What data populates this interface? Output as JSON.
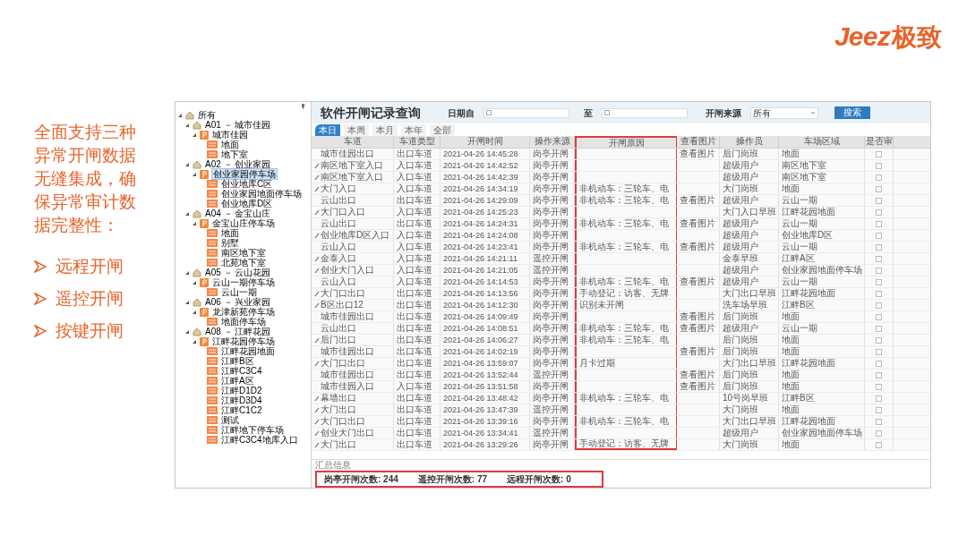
{
  "logo": {
    "latin": "Jeez",
    "chinese": "极致"
  },
  "intro": {
    "text": "全面支持三种异常开闸数据无缝集成，确保异常审计数据完整性：",
    "bullets": [
      "远程开闸",
      "遥控开闸",
      "按键开闸"
    ]
  },
  "tree": [
    {
      "label": "所有",
      "kind": "root",
      "expanded": true,
      "selected": false,
      "children": [
        {
          "label": "A01 － 城市佳园",
          "kind": "site",
          "expanded": true,
          "selected": false,
          "children": [
            {
              "label": "城市佳园",
              "kind": "lot",
              "expanded": true,
              "selected": false,
              "children": [
                {
                  "label": "地面",
                  "kind": "area",
                  "selected": false
                },
                {
                  "label": "地下室",
                  "kind": "area",
                  "selected": false
                }
              ]
            }
          ]
        },
        {
          "label": "A02 － 创业家园",
          "kind": "site",
          "expanded": true,
          "selected": false,
          "children": [
            {
              "label": "创业家园停车场",
              "kind": "lot",
              "expanded": true,
              "selected": true,
              "children": [
                {
                  "label": "创业地库C区",
                  "kind": "area",
                  "selected": false
                },
                {
                  "label": "创业家园地面停车场",
                  "kind": "area",
                  "selected": false
                },
                {
                  "label": "创业地库D区",
                  "kind": "area",
                  "selected": false
                }
              ]
            }
          ]
        },
        {
          "label": "A04 － 金宝山庄",
          "kind": "site",
          "expanded": true,
          "selected": false,
          "children": [
            {
              "label": "金宝山庄停车场",
              "kind": "lot",
              "expanded": true,
              "selected": false,
              "children": [
                {
                  "label": "地面",
                  "kind": "area",
                  "selected": false
                },
                {
                  "label": "别墅",
                  "kind": "area",
                  "selected": false
                },
                {
                  "label": "南区地下室",
                  "kind": "area",
                  "selected": false
                },
                {
                  "label": "北苑地下室",
                  "kind": "area",
                  "selected": false
                }
              ]
            }
          ]
        },
        {
          "label": "A05 － 云山花园",
          "kind": "site",
          "expanded": true,
          "selected": false,
          "children": [
            {
              "label": "云山一期停车场",
              "kind": "lot",
              "expanded": true,
              "selected": false,
              "children": [
                {
                  "label": "云山一期",
                  "kind": "area",
                  "selected": false
                }
              ]
            }
          ]
        },
        {
          "label": "A06 － 兴业家园",
          "kind": "site",
          "expanded": true,
          "selected": false,
          "children": [
            {
              "label": "龙津新苑停车场",
              "kind": "lot",
              "expanded": true,
              "selected": false,
              "children": [
                {
                  "label": "地面停车场",
                  "kind": "area",
                  "selected": false
                }
              ]
            }
          ]
        },
        {
          "label": "A08 － 江畔花园",
          "kind": "site",
          "expanded": true,
          "selected": false,
          "children": [
            {
              "label": "江畔花园停车场",
              "kind": "lot",
              "expanded": true,
              "selected": false,
              "children": [
                {
                  "label": "江畔花园地面",
                  "kind": "area",
                  "selected": false
                },
                {
                  "label": "江畔B区",
                  "kind": "area",
                  "selected": false
                },
                {
                  "label": "江畔C3C4",
                  "kind": "area",
                  "selected": false
                },
                {
                  "label": "江畔A区",
                  "kind": "area",
                  "selected": false
                },
                {
                  "label": "江畔D1D2",
                  "kind": "area",
                  "selected": false
                },
                {
                  "label": "江畔D3D4",
                  "kind": "area",
                  "selected": false
                },
                {
                  "label": "江畔C1C2",
                  "kind": "area",
                  "selected": false
                },
                {
                  "label": "测试",
                  "kind": "area",
                  "selected": false
                },
                {
                  "label": "江畔地下停车场",
                  "kind": "area",
                  "selected": false
                },
                {
                  "label": "江畔C3C4地库入口",
                  "kind": "area",
                  "selected": false
                }
              ]
            }
          ]
        }
      ]
    }
  ],
  "query": {
    "title": "软件开闸记录查询",
    "date_from": {
      "label": "日期自",
      "checked": false
    },
    "date_to": {
      "label": "至",
      "checked": false
    },
    "source": {
      "label": "开闸来源",
      "value": "所有"
    },
    "search_button": "搜索"
  },
  "tabs": [
    {
      "label": "本日",
      "selected": true
    },
    {
      "label": "本周",
      "selected": false
    },
    {
      "label": "本月",
      "selected": false
    },
    {
      "label": "本年",
      "selected": false
    },
    {
      "label": "全部",
      "selected": false
    }
  ],
  "table": {
    "columns": [
      "车道",
      "车道类型",
      "开闸时间",
      "操作来源",
      "开闸原因",
      "查看图片",
      "操作员",
      "车场区域",
      "是否审"
    ],
    "rows": [
      {
        "marked": false,
        "cells": [
          "城市佳园出口",
          "出口车道",
          "2021-04-26 14:45:28",
          "岗亭开闸",
          "",
          "查看图片",
          "后门岗班",
          "地面"
        ],
        "checked": false
      },
      {
        "marked": true,
        "cells": [
          "南区地下室入口",
          "入口车道",
          "2021-04-26 14:42:52",
          "岗亭开闸",
          "",
          "",
          "超级用户",
          "南区地下室"
        ],
        "checked": false
      },
      {
        "marked": true,
        "cells": [
          "南区地下室入口",
          "入口车道",
          "2021-04-26 14:42:39",
          "岗亭开闸",
          "",
          "",
          "超级用户",
          "南区地下室"
        ],
        "checked": false
      },
      {
        "marked": true,
        "cells": [
          "大门入口",
          "入口车道",
          "2021-04-26 14:34:19",
          "岗亭开闸",
          "非机动车：三轮车、电",
          "",
          "大门岗班",
          "地面"
        ],
        "checked": false
      },
      {
        "marked": false,
        "cells": [
          "云山出口",
          "出口车道",
          "2021-04-26 14:29:09",
          "岗亭开闸",
          "非机动车：三轮车、电",
          "查看图片",
          "超级用户",
          "云山一期"
        ],
        "checked": false
      },
      {
        "marked": true,
        "cells": [
          "大门口入口",
          "入口车道",
          "2021-04-26 14:25:23",
          "岗亭开闸",
          "",
          "",
          "大门入口早班",
          "江畔花园地面"
        ],
        "checked": false
      },
      {
        "marked": false,
        "cells": [
          "云山出口",
          "出口车道",
          "2021-04-26 14:24:31",
          "岗亭开闸",
          "非机动车：三轮车、电",
          "查看图片",
          "超级用户",
          "云山一期"
        ],
        "checked": false
      },
      {
        "marked": true,
        "cells": [
          "创业地库D区入口",
          "入口车道",
          "2021-04-26 14:24:08",
          "岗亭开闸",
          "",
          "",
          "超级用户",
          "创业地库D区"
        ],
        "checked": false
      },
      {
        "marked": false,
        "cells": [
          "云山入口",
          "入口车道",
          "2021-04-26 14:23:41",
          "岗亭开闸",
          "非机动车：三轮车、电",
          "查看图片",
          "超级用户",
          "云山一期"
        ],
        "checked": false
      },
      {
        "marked": true,
        "cells": [
          "金泰入口",
          "入口车道",
          "2021-04-26 14:21:11",
          "遥控开闸",
          "",
          "",
          "金泰早班",
          "江畔A区"
        ],
        "checked": false
      },
      {
        "marked": true,
        "cells": [
          "创业大门入口",
          "入口车道",
          "2021-04-26 14:21:05",
          "遥控开闸",
          "",
          "",
          "超级用户",
          "创业家园地面停车场"
        ],
        "checked": false
      },
      {
        "marked": false,
        "cells": [
          "云山入口",
          "入口车道",
          "2021-04-26 14:14:53",
          "岗亭开闸",
          "非机动车：三轮车、电",
          "查看图片",
          "超级用户",
          "云山一期"
        ],
        "checked": false
      },
      {
        "marked": true,
        "cells": [
          "大门口出口",
          "出口车道",
          "2021-04-26 14:13:56",
          "岗亭开闸",
          "手动登记：访客、无牌",
          "",
          "大门出口早班",
          "江畔花园地面"
        ],
        "checked": false
      },
      {
        "marked": true,
        "cells": [
          "B区出口12",
          "出口车道",
          "2021-04-26 14:12:30",
          "岗亭开闸",
          "识别未开闸",
          "",
          "洗车场早班",
          "江畔B区"
        ],
        "checked": false
      },
      {
        "marked": false,
        "cells": [
          "城市佳园出口",
          "出口车道",
          "2021-04-26 14:09:49",
          "岗亭开闸",
          "",
          "查看图片",
          "后门岗班",
          "地面"
        ],
        "checked": false
      },
      {
        "marked": false,
        "cells": [
          "云山出口",
          "出口车道",
          "2021-04-26 14:08:51",
          "岗亭开闸",
          "非机动车：三轮车、电",
          "查看图片",
          "超级用户",
          "云山一期"
        ],
        "checked": false
      },
      {
        "marked": true,
        "cells": [
          "后门出口",
          "出口车道",
          "2021-04-26 14:06:27",
          "岗亭开闸",
          "非机动车：三轮车、电",
          "",
          "后门岗班",
          "地面"
        ],
        "checked": false
      },
      {
        "marked": false,
        "cells": [
          "城市佳园出口",
          "出口车道",
          "2021-04-26 14:02:19",
          "岗亭开闸",
          "",
          "查看图片",
          "后门岗班",
          "地面"
        ],
        "checked": false
      },
      {
        "marked": true,
        "cells": [
          "大门口出口",
          "出口车道",
          "2021-04-26 13:59:07",
          "岗亭开闸",
          "月卡过期",
          "",
          "大门出口早班",
          "江畔花园地面"
        ],
        "checked": false
      },
      {
        "marked": false,
        "cells": [
          "城市佳园出口",
          "出口车道",
          "2021-04-26 13:52:44",
          "遥控开闸",
          "",
          "查看图片",
          "后门岗班",
          "地面"
        ],
        "checked": false
      },
      {
        "marked": false,
        "cells": [
          "城市佳园入口",
          "入口车道",
          "2021-04-26 13:51:58",
          "岗亭开闸",
          "",
          "查看图片",
          "后门岗班",
          "地面"
        ],
        "checked": false
      },
      {
        "marked": true,
        "cells": [
          "幕墙出口",
          "出口车道",
          "2021-04-26 13:48:42",
          "岗亭开闸",
          "非机动车：三轮车、电",
          "",
          "10号岗早班",
          "江畔B区"
        ],
        "checked": false
      },
      {
        "marked": true,
        "cells": [
          "大门出口",
          "出口车道",
          "2021-04-26 13:47:39",
          "遥控开闸",
          "",
          "",
          "大门岗班",
          "地面"
        ],
        "checked": false
      },
      {
        "marked": true,
        "cells": [
          "大门口出口",
          "出口车道",
          "2021-04-26 13:39:16",
          "岗亭开闸",
          "非机动车：三轮车、电",
          "",
          "大门出口早班",
          "江畔花园地面"
        ],
        "checked": false
      },
      {
        "marked": true,
        "cells": [
          "创业大门出口",
          "出口车道",
          "2021-04-26 13:34:41",
          "遥控开闸",
          "",
          "",
          "超级用户",
          "创业家园地面停车场"
        ],
        "checked": false
      },
      {
        "marked": true,
        "cells": [
          "大门出口",
          "出口车道",
          "2021-04-26 13:29:26",
          "岗亭开闸",
          "手动登记：访客、无牌",
          "",
          "大门岗班",
          "地面"
        ],
        "checked": false
      }
    ]
  },
  "summary": {
    "label": "汇总信息",
    "counts": [
      "岗亭开闸次数: 244",
      "遥控开闸次数: 77",
      "远程开闸次数: 0"
    ]
  }
}
